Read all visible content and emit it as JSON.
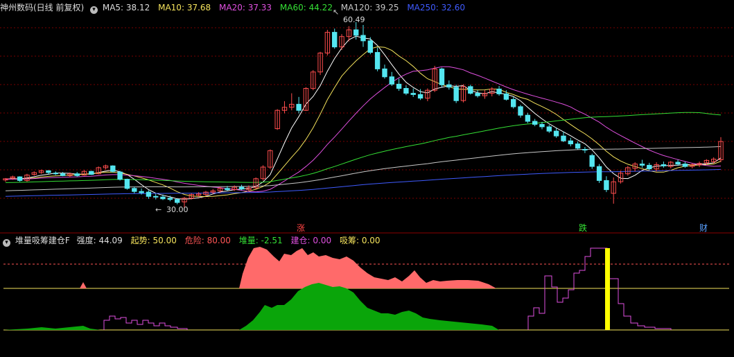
{
  "main_panel": {
    "title": "神州数码(日线 前复权)",
    "ma": [
      {
        "label": "MA5:",
        "value": "38.12",
        "color": "#ffffff"
      },
      {
        "label": "MA10:",
        "value": "37.68",
        "color": "#f5e35c"
      },
      {
        "label": "MA20:",
        "value": "37.33",
        "color": "#e050e0"
      },
      {
        "label": "MA60:",
        "value": "44.22",
        "color": "#35e035"
      },
      {
        "label": "MA120:",
        "value": "39.25",
        "color": "#c8c8c8"
      },
      {
        "label": "MA250:",
        "value": "32.60",
        "color": "#3f5bff"
      }
    ],
    "high_label": "60.49",
    "low_label": "30.00",
    "markers": [
      {
        "text": "涨",
        "color": "#ff4444"
      },
      {
        "text": "跌",
        "color": "#35e035"
      },
      {
        "text": "财",
        "color": "#5aa0ff"
      }
    ]
  },
  "indicator_panel": {
    "title": "堆量吸筹建仓F",
    "fields": [
      {
        "label": "强度:",
        "value": "44.09",
        "color": "#dddddd"
      },
      {
        "label": "起势:",
        "value": "50.00",
        "color": "#f5e35c"
      },
      {
        "label": "危险:",
        "value": "80.00",
        "color": "#ff5555"
      },
      {
        "label": "堆量:",
        "value": "-2.51",
        "color": "#35e035"
      },
      {
        "label": "建仓:",
        "value": "0.00",
        "color": "#e050e0"
      },
      {
        "label": "吸筹:",
        "value": "0.00",
        "color": "#f5e35c"
      }
    ]
  },
  "chart_data": {
    "type": "candlestick",
    "candles": [
      [
        34.6,
        34.9,
        34.3,
        34.8
      ],
      [
        34.9,
        35.3,
        34.6,
        35.1
      ],
      [
        35.1,
        35.2,
        34.3,
        34.5
      ],
      [
        34.5,
        35.6,
        34.3,
        35.4
      ],
      [
        35.5,
        36.0,
        35.3,
        35.8
      ],
      [
        35.8,
        36.3,
        35.6,
        36.1
      ],
      [
        36.1,
        36.2,
        35.5,
        35.8
      ],
      [
        35.7,
        36.0,
        35.4,
        35.6
      ],
      [
        35.6,
        35.9,
        35.2,
        35.3
      ],
      [
        35.3,
        35.8,
        35.0,
        35.6
      ],
      [
        35.6,
        35.9,
        35.1,
        35.3
      ],
      [
        35.4,
        36.2,
        35.3,
        36.0
      ],
      [
        36.0,
        36.1,
        35.4,
        35.5
      ],
      [
        35.6,
        36.8,
        35.5,
        36.6
      ],
      [
        36.6,
        37.1,
        36.3,
        36.9
      ],
      [
        36.9,
        37.0,
        35.8,
        36.0
      ],
      [
        35.9,
        36.1,
        34.5,
        34.7
      ],
      [
        34.7,
        34.8,
        33.0,
        33.2
      ],
      [
        33.2,
        33.5,
        32.4,
        32.7
      ],
      [
        32.7,
        33.2,
        32.2,
        32.5
      ],
      [
        32.6,
        32.9,
        31.5,
        31.9
      ],
      [
        31.9,
        32.3,
        31.4,
        31.8
      ],
      [
        31.8,
        32.2,
        31.3,
        31.5
      ],
      [
        31.6,
        32.0,
        31.1,
        31.4
      ],
      [
        31.4,
        31.6,
        30.6,
        30.9
      ],
      [
        31.0,
        31.8,
        30.0,
        31.6
      ],
      [
        31.6,
        32.4,
        31.4,
        32.2
      ],
      [
        32.1,
        32.6,
        31.8,
        32.3
      ],
      [
        32.2,
        32.8,
        32.0,
        32.6
      ],
      [
        32.6,
        33.1,
        32.3,
        32.8
      ],
      [
        32.8,
        33.5,
        32.5,
        33.2
      ],
      [
        33.2,
        33.6,
        32.8,
        33.0
      ],
      [
        33.0,
        33.7,
        32.8,
        33.4
      ],
      [
        33.4,
        33.8,
        32.9,
        33.1
      ],
      [
        33.0,
        33.7,
        32.8,
        33.3
      ],
      [
        33.3,
        35.0,
        33.1,
        34.8
      ],
      [
        34.8,
        37.0,
        34.5,
        36.7
      ],
      [
        36.7,
        39.6,
        36.4,
        39.4
      ],
      [
        43.0,
        46.2,
        42.8,
        46.0
      ],
      [
        46.0,
        47.5,
        45.5,
        46.5
      ],
      [
        46.5,
        48.8,
        46.0,
        47.0
      ],
      [
        47.0,
        48.2,
        45.5,
        46.0
      ],
      [
        46.0,
        49.8,
        45.9,
        49.6
      ],
      [
        49.6,
        52.6,
        49.3,
        52.3
      ],
      [
        52.3,
        55.6,
        51.8,
        55.4
      ],
      [
        55.4,
        59.2,
        55.0,
        58.8
      ],
      [
        58.8,
        59.4,
        56.1,
        56.4
      ],
      [
        56.4,
        58.5,
        55.9,
        58.1
      ],
      [
        58.1,
        59.8,
        57.3,
        59.2
      ],
      [
        59.2,
        60.49,
        57.6,
        58.3
      ],
      [
        58.3,
        60.0,
        56.4,
        57.4
      ],
      [
        57.4,
        58.0,
        55.2,
        55.5
      ],
      [
        55.5,
        56.3,
        52.4,
        52.8
      ],
      [
        52.8,
        53.5,
        51.2,
        51.5
      ],
      [
        51.5,
        52.3,
        50.0,
        50.3
      ],
      [
        50.3,
        51.2,
        49.2,
        49.6
      ],
      [
        49.6,
        50.1,
        48.5,
        48.8
      ],
      [
        48.8,
        49.6,
        48.2,
        48.6
      ],
      [
        48.6,
        49.5,
        47.7,
        48.0
      ],
      [
        48.0,
        49.6,
        47.5,
        49.3
      ],
      [
        49.3,
        53.3,
        49.0,
        52.8
      ],
      [
        52.8,
        53.0,
        49.8,
        50.2
      ],
      [
        50.2,
        50.9,
        49.4,
        49.8
      ],
      [
        49.8,
        50.2,
        47.2,
        47.6
      ],
      [
        47.6,
        50.3,
        47.3,
        49.9
      ],
      [
        49.9,
        50.2,
        48.6,
        48.8
      ],
      [
        48.8,
        49.3,
        48.1,
        48.4
      ],
      [
        48.4,
        49.3,
        47.9,
        48.8
      ],
      [
        48.8,
        49.8,
        48.3,
        49.5
      ],
      [
        49.5,
        50.0,
        48.4,
        48.7
      ],
      [
        48.7,
        49.3,
        47.6,
        47.8
      ],
      [
        47.8,
        48.2,
        46.3,
        46.6
      ],
      [
        46.6,
        46.9,
        44.8,
        45.2
      ],
      [
        45.2,
        45.6,
        43.9,
        44.2
      ],
      [
        44.2,
        44.6,
        43.4,
        43.7
      ],
      [
        43.7,
        44.1,
        42.9,
        43.3
      ],
      [
        43.3,
        43.6,
        42.3,
        42.6
      ],
      [
        42.6,
        43.1,
        41.5,
        41.8
      ],
      [
        41.8,
        42.5,
        40.8,
        41.0
      ],
      [
        41.0,
        41.5,
        40.1,
        40.5
      ],
      [
        40.5,
        40.9,
        39.6,
        39.8
      ],
      [
        39.6,
        40.0,
        39.0,
        39.5
      ],
      [
        38.6,
        38.9,
        36.4,
        36.8
      ],
      [
        36.8,
        37.2,
        34.1,
        34.5
      ],
      [
        34.5,
        35.2,
        32.6,
        33.0
      ],
      [
        32.4,
        35.0,
        30.7,
        34.3
      ],
      [
        34.3,
        36.1,
        34.0,
        35.7
      ],
      [
        35.6,
        36.9,
        35.3,
        36.6
      ],
      [
        36.5,
        37.5,
        36.0,
        37.2
      ],
      [
        37.2,
        37.9,
        36.6,
        37.0
      ],
      [
        37.0,
        37.4,
        36.2,
        36.4
      ],
      [
        36.4,
        37.5,
        36.0,
        37.1
      ],
      [
        37.1,
        37.6,
        36.6,
        36.9
      ],
      [
        36.8,
        37.7,
        36.5,
        37.5
      ],
      [
        37.5,
        37.9,
        36.9,
        37.2
      ],
      [
        37.2,
        37.6,
        36.6,
        36.8
      ],
      [
        36.8,
        37.3,
        36.5,
        37.1
      ],
      [
        37.1,
        37.6,
        36.7,
        37.3
      ],
      [
        37.4,
        38.0,
        37.1,
        37.8
      ],
      [
        37.6,
        38.3,
        37.3,
        38.0
      ],
      [
        37.9,
        41.6,
        37.5,
        40.9
      ]
    ],
    "moving_averages": [
      "MA5",
      "MA10",
      "MA20",
      "MA60",
      "MA120",
      "MA250"
    ],
    "indicator": {
      "series": [
        "强度",
        "起势",
        "危险",
        "堆量",
        "建仓",
        "吸筹"
      ],
      "levels": {
        "危险": 80,
        "起势": 50
      }
    }
  },
  "colors": {
    "up": "#ff4d4d",
    "down": "#54e6f0",
    "background": "#000000",
    "grid": "#7a0000",
    "separator": "#8b0000",
    "indicator_red_fill": "#ff6a6a",
    "indicator_green_fill": "#0aa50a",
    "indicator_yellow_bar": "#ffff00"
  }
}
